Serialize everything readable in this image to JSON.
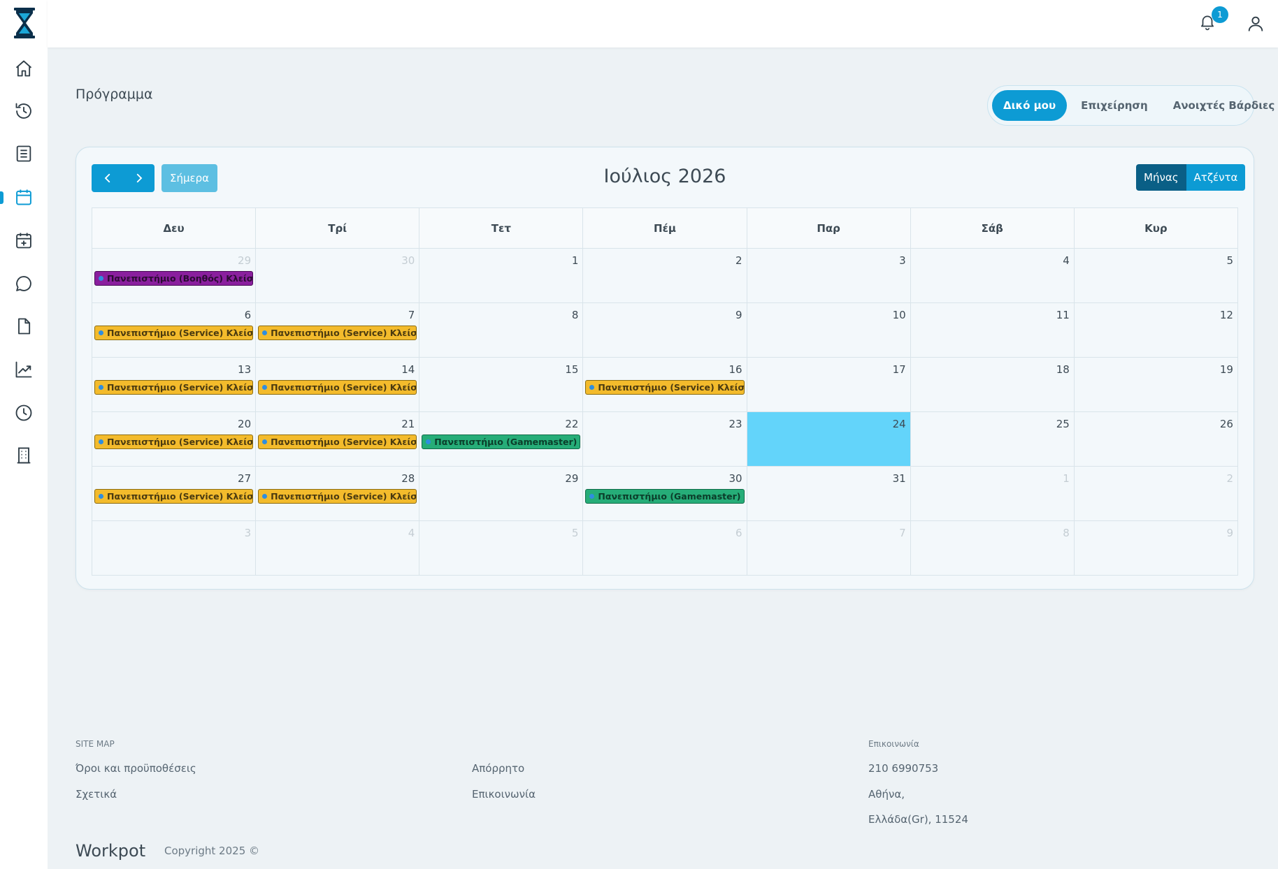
{
  "sidebar": {
    "items": [
      {
        "name": "home-icon"
      },
      {
        "name": "history-icon"
      },
      {
        "name": "document-list-icon"
      },
      {
        "name": "calendar-icon",
        "active": true
      },
      {
        "name": "calendar-add-icon"
      },
      {
        "name": "chat-icon"
      },
      {
        "name": "file-icon"
      },
      {
        "name": "chart-icon"
      },
      {
        "name": "clock-icon"
      },
      {
        "name": "building-icon"
      }
    ]
  },
  "topbar": {
    "notification_count": "1"
  },
  "page": {
    "title": "Πρόγραμμα"
  },
  "segments": {
    "mine": "Δικό μου",
    "business": "Επιχείρηση",
    "open_shifts": "Ανοιχτές Βάρδιες"
  },
  "calendar": {
    "title": "Ιούλιος 2026",
    "today_label": "Σήμερα",
    "view_month": "Μήνας",
    "view_agenda": "Ατζέντα",
    "weekdays": [
      "Δευ",
      "Τρί",
      "Τετ",
      "Πέμ",
      "Παρ",
      "Σάβ",
      "Κυρ"
    ],
    "weeks": [
      [
        {
          "day": "29",
          "other": true,
          "event": {
            "type": "helper",
            "label": "Πανεπιστήμιο (Βοηθός) Κλείσιμο"
          }
        },
        {
          "day": "30",
          "other": true
        },
        {
          "day": "1"
        },
        {
          "day": "2"
        },
        {
          "day": "3"
        },
        {
          "day": "4"
        },
        {
          "day": "5"
        }
      ],
      [
        {
          "day": "6",
          "event": {
            "type": "service",
            "label": "Πανεπιστήμιο (Service) Κλείσιμο"
          }
        },
        {
          "day": "7",
          "event": {
            "type": "service",
            "label": "Πανεπιστήμιο (Service) Κλείσιμο"
          }
        },
        {
          "day": "8"
        },
        {
          "day": "9"
        },
        {
          "day": "10"
        },
        {
          "day": "11"
        },
        {
          "day": "12"
        }
      ],
      [
        {
          "day": "13",
          "event": {
            "type": "service",
            "label": "Πανεπιστήμιο (Service) Κλείσιμο"
          }
        },
        {
          "day": "14",
          "event": {
            "type": "service",
            "label": "Πανεπιστήμιο (Service) Κλείσιμο"
          }
        },
        {
          "day": "15"
        },
        {
          "day": "16",
          "event": {
            "type": "service",
            "label": "Πανεπιστήμιο (Service) Κλείσιμο"
          }
        },
        {
          "day": "17"
        },
        {
          "day": "18"
        },
        {
          "day": "19"
        }
      ],
      [
        {
          "day": "20",
          "event": {
            "type": "service",
            "label": "Πανεπιστήμιο (Service) Κλείσιμο"
          }
        },
        {
          "day": "21",
          "event": {
            "type": "service",
            "label": "Πανεπιστήμιο (Service) Κλείσιμο"
          }
        },
        {
          "day": "22",
          "event": {
            "type": "gm",
            "label": "Πανεπιστήμιο (Gamemaster) Κλεί"
          }
        },
        {
          "day": "23"
        },
        {
          "day": "24",
          "today": true
        },
        {
          "day": "25"
        },
        {
          "day": "26"
        }
      ],
      [
        {
          "day": "27",
          "event": {
            "type": "service",
            "label": "Πανεπιστήμιο (Service) Κλείσιμο"
          }
        },
        {
          "day": "28",
          "event": {
            "type": "service",
            "label": "Πανεπιστήμιο (Service) Κλείσιμο"
          }
        },
        {
          "day": "29"
        },
        {
          "day": "30",
          "event": {
            "type": "gm",
            "label": "Πανεπιστήμιο (Gamemaster) Κλεί"
          }
        },
        {
          "day": "31"
        },
        {
          "day": "1",
          "other": true
        },
        {
          "day": "2",
          "other": true
        }
      ],
      [
        {
          "day": "3",
          "other": true
        },
        {
          "day": "4",
          "other": true
        },
        {
          "day": "5",
          "other": true
        },
        {
          "day": "6",
          "other": true
        },
        {
          "day": "7",
          "other": true
        },
        {
          "day": "8",
          "other": true
        },
        {
          "day": "9",
          "other": true
        }
      ]
    ]
  },
  "colors": {
    "accent": "#0d9bd4",
    "today_cell": "#63d4fa",
    "service_event": "#f3bb2c",
    "helper_event": "#8a1f9e",
    "gamemaster_event": "#26ad78"
  },
  "footer": {
    "sitemap_label": "SITE MAP",
    "terms": "Όροι και προϋποθέσεις",
    "about": "Σχετικά",
    "privacy": "Απόρρητο",
    "contact_link": "Επικοινωνία",
    "contact_label": "Επικοινωνία",
    "phone": "210 6990753",
    "city": "Αθήνα,",
    "country": "Ελλάδα(Gr), 11524",
    "brand": "Workpot",
    "copyright": "Copyright 2025 ©"
  }
}
